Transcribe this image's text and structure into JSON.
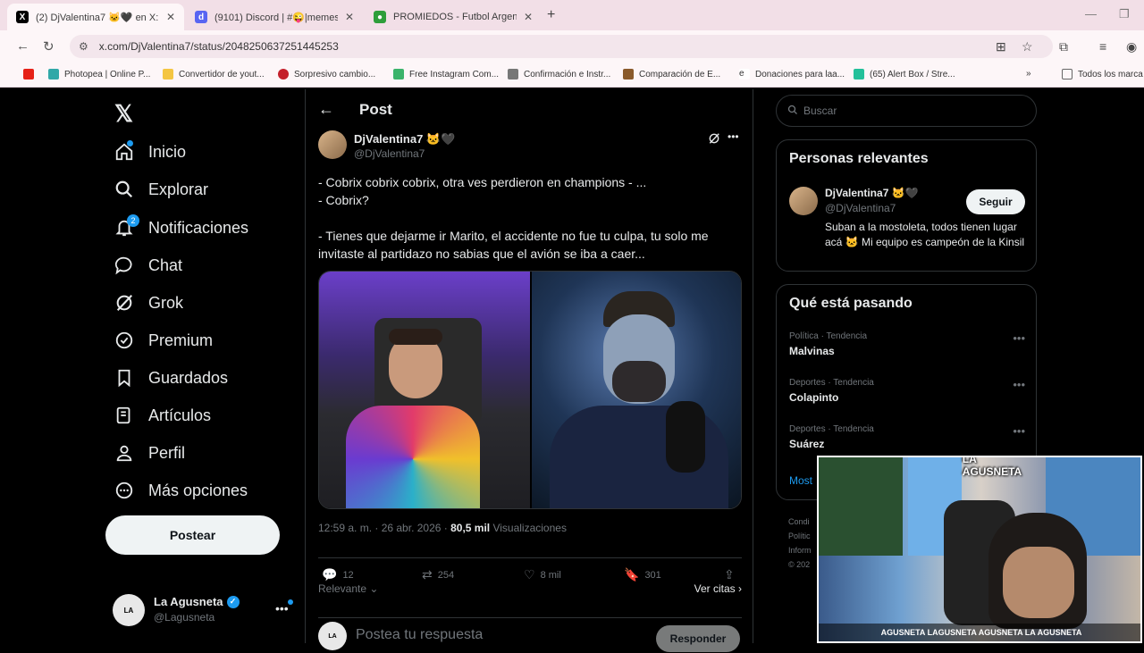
{
  "browser": {
    "tabs": [
      {
        "title": "(2) DjValentina7 🐱🖤 en X: \"-",
        "active": true
      },
      {
        "title": "(9101) Discord | #😜|memes |",
        "active": false
      },
      {
        "title": "PROMIEDOS - Futbol Argentino",
        "active": false
      }
    ],
    "url": "x.com/DjValentina7/status/2048250637251445253",
    "bookmarks": [
      "Photopea | Online P...",
      "Convertidor de yout...",
      "Sorpresivo cambio...",
      "Free Instagram Com...",
      "Confirmación e Instr...",
      "Comparación de E...",
      "Donaciones para laa...",
      "(65) Alert Box / Stre...",
      "Todos los marca"
    ]
  },
  "nav": {
    "items": [
      {
        "label": "Inicio",
        "icon": "home-icon"
      },
      {
        "label": "Explorar",
        "icon": "search-icon"
      },
      {
        "label": "Notificaciones",
        "icon": "bell-icon",
        "badge": "2"
      },
      {
        "label": "Chat",
        "icon": "chat-icon"
      },
      {
        "label": "Grok",
        "icon": "grok-icon"
      },
      {
        "label": "Premium",
        "icon": "premium-icon"
      },
      {
        "label": "Guardados",
        "icon": "bookmark-icon"
      },
      {
        "label": "Artículos",
        "icon": "articles-icon"
      },
      {
        "label": "Perfil",
        "icon": "person-icon"
      },
      {
        "label": "Más opciones",
        "icon": "more-circle-icon"
      }
    ],
    "post_button": "Postear",
    "account": {
      "name": "La Agusneta",
      "handle": "@Lagusneta"
    }
  },
  "main": {
    "header": "Post",
    "author": {
      "name": "DjValentina7 🐱🖤",
      "handle": "@DjValentina7"
    },
    "text": "- Cobrix cobrix cobrix, otra ves perdieron en champions  - ...\n- Cobrix?\n\n- Tienes que dejarme ir Marito, el accidente no fue tu culpa, tu solo me invitaste al partidazo no sabias que el avión se iba a caer...",
    "meta_time": "12:59 a. m. · 26 abr. 2026 · ",
    "meta_views": "80,5 mil",
    "meta_views_label": " Visualizaciones",
    "actions": {
      "replies": "12",
      "reposts": "254",
      "likes": "8 mil",
      "bookmarks": "301"
    },
    "relevante": "Relevante",
    "ver_citas": "Ver citas",
    "reply_placeholder": "Postea tu respuesta",
    "reply_button": "Responder"
  },
  "right": {
    "search_placeholder": "Buscar",
    "people_title": "Personas relevantes",
    "person": {
      "name": "DjValentina7 🐱🖤",
      "handle": "@DjValentina7",
      "bio": "Suban a la mostoleta, todos tienen lugar acá 🐱 Mi equipo es campeón de la Kinsil",
      "follow": "Seguir"
    },
    "trends_title": "Qué está pasando",
    "trends": [
      {
        "category": "Política · Tendencia",
        "name": "Malvinas"
      },
      {
        "category": "Deportes · Tendencia",
        "name": "Colapinto"
      },
      {
        "category": "Deportes · Tendencia",
        "name": "Suárez"
      }
    ],
    "show_more": "Most",
    "footer": [
      "Condi",
      "Polític",
      "Inform",
      "© 202"
    ]
  },
  "webcam": {
    "logo": "LA AGUSNETA",
    "socials": "AGUSNETA  LAGUSNETA  AGUSNETA  LA AGUSNETA"
  },
  "colors": {
    "accent": "#1d9bf0",
    "bg": "#000000",
    "border": "#2f3336",
    "muted": "#71767b"
  }
}
